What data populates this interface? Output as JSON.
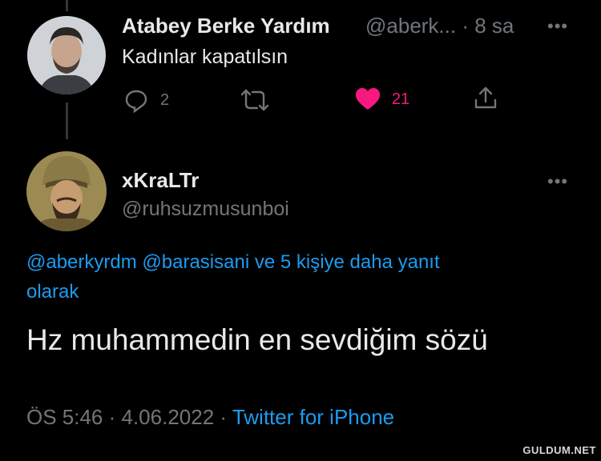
{
  "parent_tweet": {
    "display_name": "Atabey Berke Yardım",
    "handle_time": "@aberk... · 8 sa",
    "text": "Kadınlar kapatılsın",
    "reply_count": "2",
    "like_count": "21",
    "more_icon": "more-icon",
    "reply_icon": "reply-icon",
    "retweet_icon": "retweet-icon",
    "like_icon": "heart-icon",
    "share_icon": "share-icon"
  },
  "main_tweet": {
    "display_name": "xKraLTr",
    "handle": "@ruhsuzmusunboi",
    "reply_context_line1": "@aberkyrdm @barasisani ve 5 kişiye daha yanıt",
    "reply_context_line2": "olarak",
    "text": "Hz muhammedin en sevdiğim sözü",
    "timestamp": "ÖS 5:46 · 4.06.2022 ·",
    "source": "Twitter for iPhone"
  },
  "watermark": "GULDUM.NET",
  "colors": {
    "background": "#000000",
    "text": "#e7e9ea",
    "secondary": "#71767b",
    "link": "#1d9bf0",
    "like": "#f91880"
  }
}
